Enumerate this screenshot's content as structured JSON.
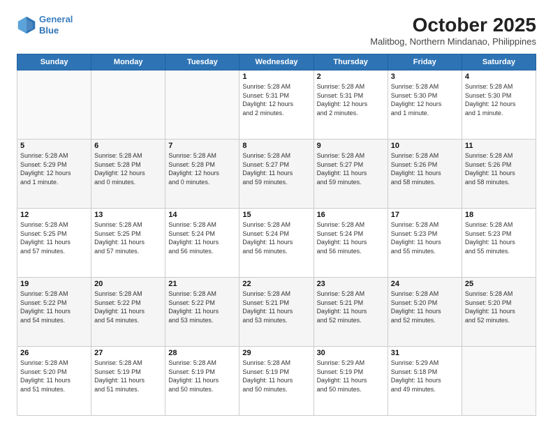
{
  "header": {
    "logo_line1": "General",
    "logo_line2": "Blue",
    "month_year": "October 2025",
    "location": "Malitbog, Northern Mindanao, Philippines"
  },
  "days_of_week": [
    "Sunday",
    "Monday",
    "Tuesday",
    "Wednesday",
    "Thursday",
    "Friday",
    "Saturday"
  ],
  "weeks": [
    [
      {
        "day": "",
        "info": ""
      },
      {
        "day": "",
        "info": ""
      },
      {
        "day": "",
        "info": ""
      },
      {
        "day": "1",
        "info": "Sunrise: 5:28 AM\nSunset: 5:31 PM\nDaylight: 12 hours\nand 2 minutes."
      },
      {
        "day": "2",
        "info": "Sunrise: 5:28 AM\nSunset: 5:31 PM\nDaylight: 12 hours\nand 2 minutes."
      },
      {
        "day": "3",
        "info": "Sunrise: 5:28 AM\nSunset: 5:30 PM\nDaylight: 12 hours\nand 1 minute."
      },
      {
        "day": "4",
        "info": "Sunrise: 5:28 AM\nSunset: 5:30 PM\nDaylight: 12 hours\nand 1 minute."
      }
    ],
    [
      {
        "day": "5",
        "info": "Sunrise: 5:28 AM\nSunset: 5:29 PM\nDaylight: 12 hours\nand 1 minute."
      },
      {
        "day": "6",
        "info": "Sunrise: 5:28 AM\nSunset: 5:28 PM\nDaylight: 12 hours\nand 0 minutes."
      },
      {
        "day": "7",
        "info": "Sunrise: 5:28 AM\nSunset: 5:28 PM\nDaylight: 12 hours\nand 0 minutes."
      },
      {
        "day": "8",
        "info": "Sunrise: 5:28 AM\nSunset: 5:27 PM\nDaylight: 11 hours\nand 59 minutes."
      },
      {
        "day": "9",
        "info": "Sunrise: 5:28 AM\nSunset: 5:27 PM\nDaylight: 11 hours\nand 59 minutes."
      },
      {
        "day": "10",
        "info": "Sunrise: 5:28 AM\nSunset: 5:26 PM\nDaylight: 11 hours\nand 58 minutes."
      },
      {
        "day": "11",
        "info": "Sunrise: 5:28 AM\nSunset: 5:26 PM\nDaylight: 11 hours\nand 58 minutes."
      }
    ],
    [
      {
        "day": "12",
        "info": "Sunrise: 5:28 AM\nSunset: 5:25 PM\nDaylight: 11 hours\nand 57 minutes."
      },
      {
        "day": "13",
        "info": "Sunrise: 5:28 AM\nSunset: 5:25 PM\nDaylight: 11 hours\nand 57 minutes."
      },
      {
        "day": "14",
        "info": "Sunrise: 5:28 AM\nSunset: 5:24 PM\nDaylight: 11 hours\nand 56 minutes."
      },
      {
        "day": "15",
        "info": "Sunrise: 5:28 AM\nSunset: 5:24 PM\nDaylight: 11 hours\nand 56 minutes."
      },
      {
        "day": "16",
        "info": "Sunrise: 5:28 AM\nSunset: 5:24 PM\nDaylight: 11 hours\nand 56 minutes."
      },
      {
        "day": "17",
        "info": "Sunrise: 5:28 AM\nSunset: 5:23 PM\nDaylight: 11 hours\nand 55 minutes."
      },
      {
        "day": "18",
        "info": "Sunrise: 5:28 AM\nSunset: 5:23 PM\nDaylight: 11 hours\nand 55 minutes."
      }
    ],
    [
      {
        "day": "19",
        "info": "Sunrise: 5:28 AM\nSunset: 5:22 PM\nDaylight: 11 hours\nand 54 minutes."
      },
      {
        "day": "20",
        "info": "Sunrise: 5:28 AM\nSunset: 5:22 PM\nDaylight: 11 hours\nand 54 minutes."
      },
      {
        "day": "21",
        "info": "Sunrise: 5:28 AM\nSunset: 5:22 PM\nDaylight: 11 hours\nand 53 minutes."
      },
      {
        "day": "22",
        "info": "Sunrise: 5:28 AM\nSunset: 5:21 PM\nDaylight: 11 hours\nand 53 minutes."
      },
      {
        "day": "23",
        "info": "Sunrise: 5:28 AM\nSunset: 5:21 PM\nDaylight: 11 hours\nand 52 minutes."
      },
      {
        "day": "24",
        "info": "Sunrise: 5:28 AM\nSunset: 5:20 PM\nDaylight: 11 hours\nand 52 minutes."
      },
      {
        "day": "25",
        "info": "Sunrise: 5:28 AM\nSunset: 5:20 PM\nDaylight: 11 hours\nand 52 minutes."
      }
    ],
    [
      {
        "day": "26",
        "info": "Sunrise: 5:28 AM\nSunset: 5:20 PM\nDaylight: 11 hours\nand 51 minutes."
      },
      {
        "day": "27",
        "info": "Sunrise: 5:28 AM\nSunset: 5:19 PM\nDaylight: 11 hours\nand 51 minutes."
      },
      {
        "day": "28",
        "info": "Sunrise: 5:28 AM\nSunset: 5:19 PM\nDaylight: 11 hours\nand 50 minutes."
      },
      {
        "day": "29",
        "info": "Sunrise: 5:28 AM\nSunset: 5:19 PM\nDaylight: 11 hours\nand 50 minutes."
      },
      {
        "day": "30",
        "info": "Sunrise: 5:29 AM\nSunset: 5:19 PM\nDaylight: 11 hours\nand 50 minutes."
      },
      {
        "day": "31",
        "info": "Sunrise: 5:29 AM\nSunset: 5:18 PM\nDaylight: 11 hours\nand 49 minutes."
      },
      {
        "day": "",
        "info": ""
      }
    ]
  ]
}
